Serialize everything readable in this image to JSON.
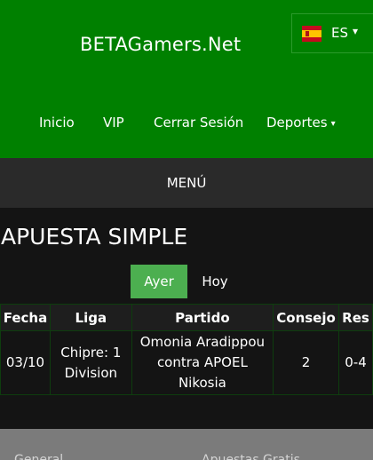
{
  "header": {
    "brand": "BETAGamers.Net",
    "language": {
      "code": "ES",
      "caret": "▾"
    },
    "nav": [
      {
        "label": "Inicio"
      },
      {
        "label": "VIP"
      },
      {
        "label": "Cerrar Sesión"
      },
      {
        "label": "Deportes",
        "caret": "▾"
      }
    ]
  },
  "menu": {
    "label": "MENÚ"
  },
  "main": {
    "title": "APUESTA SIMPLE",
    "day_tabs": [
      {
        "label": "Ayer",
        "active": true
      },
      {
        "label": "Hoy",
        "active": false
      }
    ],
    "table": {
      "headers": [
        "Fecha",
        "Liga",
        "Partido",
        "Consejo",
        "Res"
      ],
      "rows": [
        {
          "fecha": "03/10",
          "liga": "Chipre: 1 Division",
          "partido": "Omonia Aradippou contra APOEL Nikosia",
          "consejo": "2",
          "res": "0-4"
        }
      ]
    }
  },
  "footer": {
    "links": [
      {
        "label": "General"
      },
      {
        "label": "Apuestas Gratis"
      }
    ]
  },
  "colors": {
    "header_green": "#008000",
    "active_tab": "#4caf50",
    "background": "#141414",
    "menu_bar": "#2a2a2a"
  },
  "icons": {
    "language_flag": "spain-flag-icon",
    "dropdown": "chevron-down-icon"
  }
}
